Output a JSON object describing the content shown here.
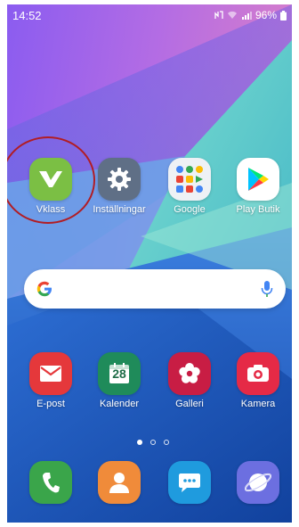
{
  "status_bar": {
    "time": "14:52",
    "battery": "96%"
  },
  "apps_row1": [
    {
      "label": "Vklass",
      "icon": "vklass-icon",
      "color": "#7bbf44"
    },
    {
      "label": "Inställningar",
      "icon": "gear-icon",
      "color": "#5f6f86"
    },
    {
      "label": "Google",
      "icon": "google-folder-icon",
      "color": "#eef1f5"
    },
    {
      "label": "Play Butik",
      "icon": "play-store-icon",
      "color": "#ffffff"
    }
  ],
  "search": {
    "brand_icon": "google-g-icon",
    "mic_icon": "microphone-icon"
  },
  "apps_row2": [
    {
      "label": "E-post",
      "icon": "envelope-icon",
      "color": "#e5383b"
    },
    {
      "label": "Kalender",
      "icon": "calendar-icon",
      "color": "#1f8b5a",
      "day": "28"
    },
    {
      "label": "Galleri",
      "icon": "flower-icon",
      "color": "#c81d44"
    },
    {
      "label": "Kamera",
      "icon": "camera-icon",
      "color": "#e52a46"
    }
  ],
  "page_indicator": {
    "pages": 3,
    "active_page": 1
  },
  "dock": [
    {
      "icon": "phone-icon",
      "color": "#3aa54a"
    },
    {
      "icon": "contacts-icon",
      "color": "#f08b3a"
    },
    {
      "icon": "messages-icon",
      "color": "#1f9bde"
    },
    {
      "icon": "internet-icon",
      "color": "#6c6fe0"
    }
  ],
  "annotation": {
    "highlight_color": "#b11d24",
    "highlighted_app": "Vklass"
  }
}
